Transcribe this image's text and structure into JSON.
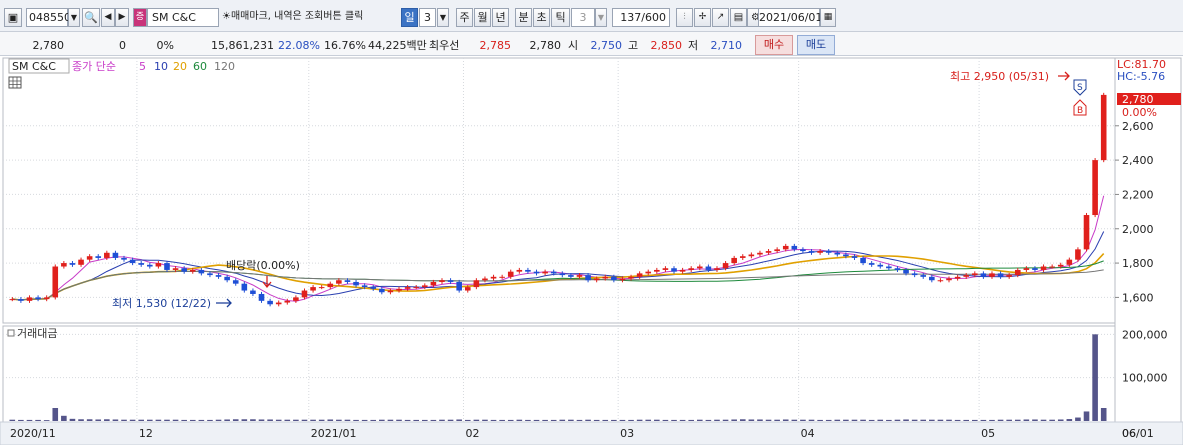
{
  "toolbar": {
    "code": "048550",
    "stock_name": "SM C&C",
    "stock_tag": "증",
    "marquee": "☀매매마크, 내역은 조회버튼 클릭",
    "period_buttons": [
      "일",
      "3",
      "주",
      "월",
      "년",
      "분",
      "초",
      "틱"
    ],
    "tick_value": "3",
    "count": "137/600",
    "date": "2021/06/01"
  },
  "info": {
    "price": "2,780",
    "change": "0",
    "change_pct": "0%",
    "volume": "15,861,231",
    "turnover": "22.08%",
    "ratio": "16.76%",
    "amount": "44,225백만",
    "label_best": "최우선",
    "ask": "2,785",
    "bid": "2,780",
    "open_label": "시",
    "open": "2,750",
    "high_label": "고",
    "high": "2,850",
    "low_label": "저",
    "low": "2,710",
    "buy_label": "매수",
    "sell_label": "매도"
  },
  "legend": {
    "name": "SM C&C",
    "ma_label": "종가 단순",
    "ma_periods": [
      "5",
      "10",
      "20",
      "60",
      "120"
    ],
    "ma_colors": [
      "#c83cc8",
      "#2a3fb0",
      "#e0a000",
      "#1e8a3c",
      "#777777"
    ],
    "lc": "LC:81.70",
    "hc": "HC:-5.76",
    "current_price": "2,780",
    "current_pct": "0.00%",
    "volume_title": "거래대금"
  },
  "annotations": {
    "high": "최고 2,950 (05/31)",
    "low": "최저 1,530 (12/22)",
    "dividend": "배당락(0.00%)",
    "sell_marker": "S",
    "buy_marker": "B"
  },
  "chart_data": {
    "type": "candlestick",
    "price_ticks": [
      "2,600",
      "2,400",
      "2,200",
      "2,000",
      "1,800",
      "1,600"
    ],
    "price_tick_values": [
      2600,
      2400,
      2200,
      2000,
      1800,
      1600
    ],
    "ylim": [
      1480,
      2960
    ],
    "volume_ticks": [
      "200,000",
      "100,000"
    ],
    "volume_tick_values": [
      200000,
      100000
    ],
    "volume_ylim": [
      0,
      210000
    ],
    "x_labels": [
      "2020/11",
      "12",
      "2021/01",
      "02",
      "03",
      "04",
      "05",
      "06",
      "06/01"
    ],
    "x_label_index": [
      0,
      15,
      35,
      53,
      71,
      92,
      113,
      133,
      137
    ],
    "seed_close": 1590,
    "closes": [
      1590,
      1580,
      1600,
      1590,
      1600,
      1780,
      1800,
      1790,
      1820,
      1840,
      1830,
      1860,
      1830,
      1820,
      1800,
      1790,
      1780,
      1800,
      1760,
      1770,
      1750,
      1760,
      1740,
      1730,
      1720,
      1700,
      1680,
      1640,
      1620,
      1580,
      1560,
      1570,
      1580,
      1600,
      1640,
      1660,
      1660,
      1680,
      1700,
      1690,
      1670,
      1660,
      1650,
      1630,
      1640,
      1650,
      1660,
      1660,
      1670,
      1690,
      1700,
      1690,
      1640,
      1660,
      1700,
      1710,
      1720,
      1720,
      1750,
      1760,
      1750,
      1740,
      1750,
      1740,
      1730,
      1720,
      1730,
      1700,
      1710,
      1720,
      1700,
      1710,
      1720,
      1740,
      1750,
      1760,
      1770,
      1750,
      1760,
      1770,
      1780,
      1760,
      1770,
      1800,
      1830,
      1840,
      1850,
      1860,
      1870,
      1880,
      1900,
      1880,
      1870,
      1860,
      1870,
      1860,
      1850,
      1840,
      1830,
      1800,
      1790,
      1780,
      1770,
      1760,
      1740,
      1730,
      1720,
      1700,
      1700,
      1710,
      1720,
      1730,
      1740,
      1720,
      1740,
      1720,
      1730,
      1760,
      1770,
      1760,
      1780,
      1780,
      1790,
      1820,
      1880,
      2080,
      2400,
      2780
    ],
    "volumes": [
      3000,
      2500,
      2500,
      2500,
      2000,
      30000,
      12000,
      5000,
      4000,
      4000,
      3500,
      4000,
      3500,
      3000,
      3000,
      3000,
      3000,
      3000,
      3000,
      3000,
      2500,
      2500,
      2500,
      2500,
      3000,
      3500,
      4000,
      4000,
      4000,
      3500,
      3500,
      3000,
      3000,
      3000,
      3000,
      3000,
      3000,
      3500,
      3000,
      3000,
      2500,
      2500,
      2500,
      3000,
      3000,
      3000,
      2500,
      2500,
      2500,
      2500,
      3000,
      3000,
      3500,
      2500,
      3000,
      3000,
      2500,
      2500,
      2500,
      3000,
      2500,
      2500,
      2500,
      2500,
      3000,
      3000,
      2500,
      3000,
      2500,
      2500,
      2500,
      2500,
      2500,
      3000,
      3000,
      3000,
      2500,
      2500,
      2500,
      2500,
      3000,
      2500,
      3000,
      3000,
      3500,
      4000,
      3500,
      3500,
      3000,
      3000,
      3500,
      3000,
      3000,
      3000,
      2500,
      2500,
      3000,
      3000,
      3000,
      3000,
      2500,
      3000,
      2500,
      3000,
      3500,
      3000,
      3000,
      3000,
      3000,
      3000,
      2500,
      2500,
      2500,
      2500,
      2500,
      3000,
      3000,
      3000,
      3500,
      3500,
      3000,
      3000,
      3500,
      4500,
      8000,
      22000,
      200000,
      30000
    ]
  }
}
